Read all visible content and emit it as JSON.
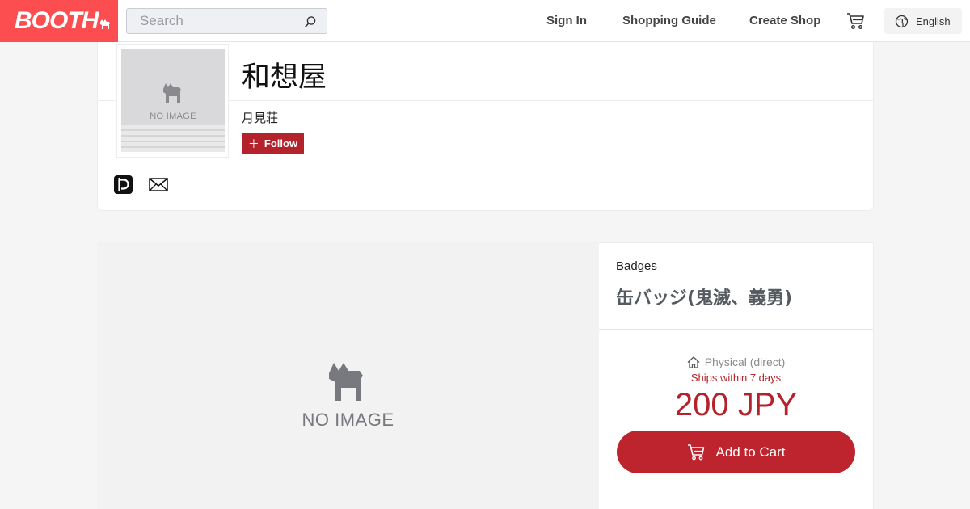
{
  "header": {
    "logo_text": "BOOTH",
    "search_placeholder": "Search",
    "sign_in": "Sign In",
    "shopping_guide": "Shopping Guide",
    "create_shop": "Create Shop",
    "language": "English",
    "icons": [
      "search-icon",
      "cart-icon",
      "globe-icon"
    ],
    "brand_color": "#fc4d50"
  },
  "shop": {
    "thumbnail_text": "NO IMAGE",
    "name": "和想屋",
    "owner": "月見荘",
    "follow_label": "Follow",
    "links": [
      "pixiv-icon",
      "mail-icon"
    ]
  },
  "item": {
    "image_text": "NO IMAGE",
    "category": "Badges",
    "title": "缶バッジ(鬼滅、義勇)",
    "shipping_type": "Physical (direct)",
    "ships_within": "Ships within 7 days",
    "price": "200 JPY",
    "add_to_cart": "Add to Cart",
    "accent_color": "#b4232c"
  }
}
